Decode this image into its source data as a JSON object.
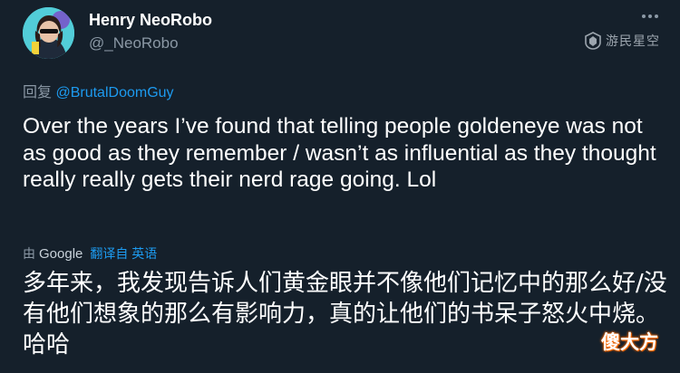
{
  "user": {
    "display_name": "Henry NeoRobo",
    "handle": "@_NeoRobo"
  },
  "reply": {
    "prefix": "回复",
    "mention": "@BrutalDoomGuy"
  },
  "tweet": {
    "text": "Over the years I’ve found that telling people goldeneye was not as good as they remember / wasn’t as influential as they thought really really gets their nerd rage going. Lol"
  },
  "translation": {
    "by_label": "由",
    "engine": "Google",
    "link": "翻译自 英语",
    "text": "多年来，我发现告诉人们黄金眼并不像他们记忆中的那么好/没有他们想象的那么有影响力，真的让他们的书呆子怒火中烧。哈哈"
  },
  "watermarks": {
    "top": "游民星空",
    "bottom": "傻大方"
  },
  "colors": {
    "background": "#15202b",
    "text": "#ffffff",
    "secondary": "#8b98a5",
    "link": "#1d9bf0"
  },
  "icons": {
    "more": "more-horizontal-icon",
    "google": "google-logo"
  }
}
